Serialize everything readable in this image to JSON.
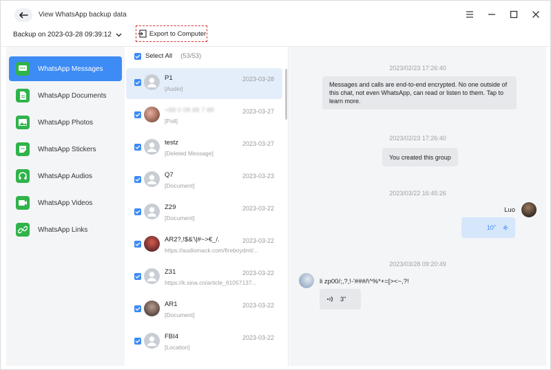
{
  "header": {
    "title": "View WhatsApp backup data",
    "backup_label": "Backup on 2023-03-28 09:39:12",
    "export_label": "Export to Computer"
  },
  "sidebar": {
    "items": [
      {
        "label": "WhatsApp Messages",
        "icon": "chat-icon",
        "active": true
      },
      {
        "label": "WhatsApp Documents",
        "icon": "document-icon"
      },
      {
        "label": "WhatsApp Photos",
        "icon": "photo-icon"
      },
      {
        "label": "WhatsApp Stickers",
        "icon": "sticker-icon"
      },
      {
        "label": "WhatsApp Audios",
        "icon": "headphones-icon"
      },
      {
        "label": "WhatsApp Videos",
        "icon": "video-icon"
      },
      {
        "label": "WhatsApp Links",
        "icon": "link-icon"
      }
    ]
  },
  "chatlist": {
    "select_all": "Select All",
    "count": "(53/53)",
    "items": [
      {
        "name": "P1",
        "date": "2023-03-28",
        "sub": "[Audio]"
      },
      {
        "name": "+88 0 08 88 7 88",
        "date": "2023-03-27",
        "sub": "[Poll]"
      },
      {
        "name": "testz",
        "date": "2023-03-27",
        "sub": "[Deleted Message]"
      },
      {
        "name": "Q7",
        "date": "2023-03-23",
        "sub": "[Document]"
      },
      {
        "name": "Z29",
        "date": "2023-03-22",
        "sub": "[Document]"
      },
      {
        "name": "AR2?,!$&'\\|#~>€_/.",
        "date": "2023-03-22",
        "sub": "https://audiomack.com/fireboydml/..."
      },
      {
        "name": "Z31",
        "date": "2023-03-22",
        "sub": "https://k.sina.cn/article_61057137..."
      },
      {
        "name": "AR1",
        "date": "2023-03-22",
        "sub": "[Document]"
      },
      {
        "name": "FBI4",
        "date": "2023-03-22",
        "sub": "[Location]"
      }
    ]
  },
  "conversation": {
    "ts1": "2023/02/23 17:26:40",
    "msg1": "Messages and calls are end-to-end encrypted. No one outside of this chat, not even WhatsApp, can read or listen to them. Tap to learn more.",
    "ts2": "2023/02/23 17:26:40",
    "msg2": "You created this group",
    "ts3": "2023/03/22 16:45:26",
    "sender1": "Luo",
    "audio1": "10\"",
    "ts4": "2023/03/28 09:20:49",
    "sender2": "li zp00/;,?,!-'###/\\^%*+=[><~,?!",
    "audio2": "3\""
  },
  "colors": {
    "accent": "#3d8bf5",
    "whatsapp_green": "#2fb34a",
    "export_border": "#d32f2f"
  }
}
